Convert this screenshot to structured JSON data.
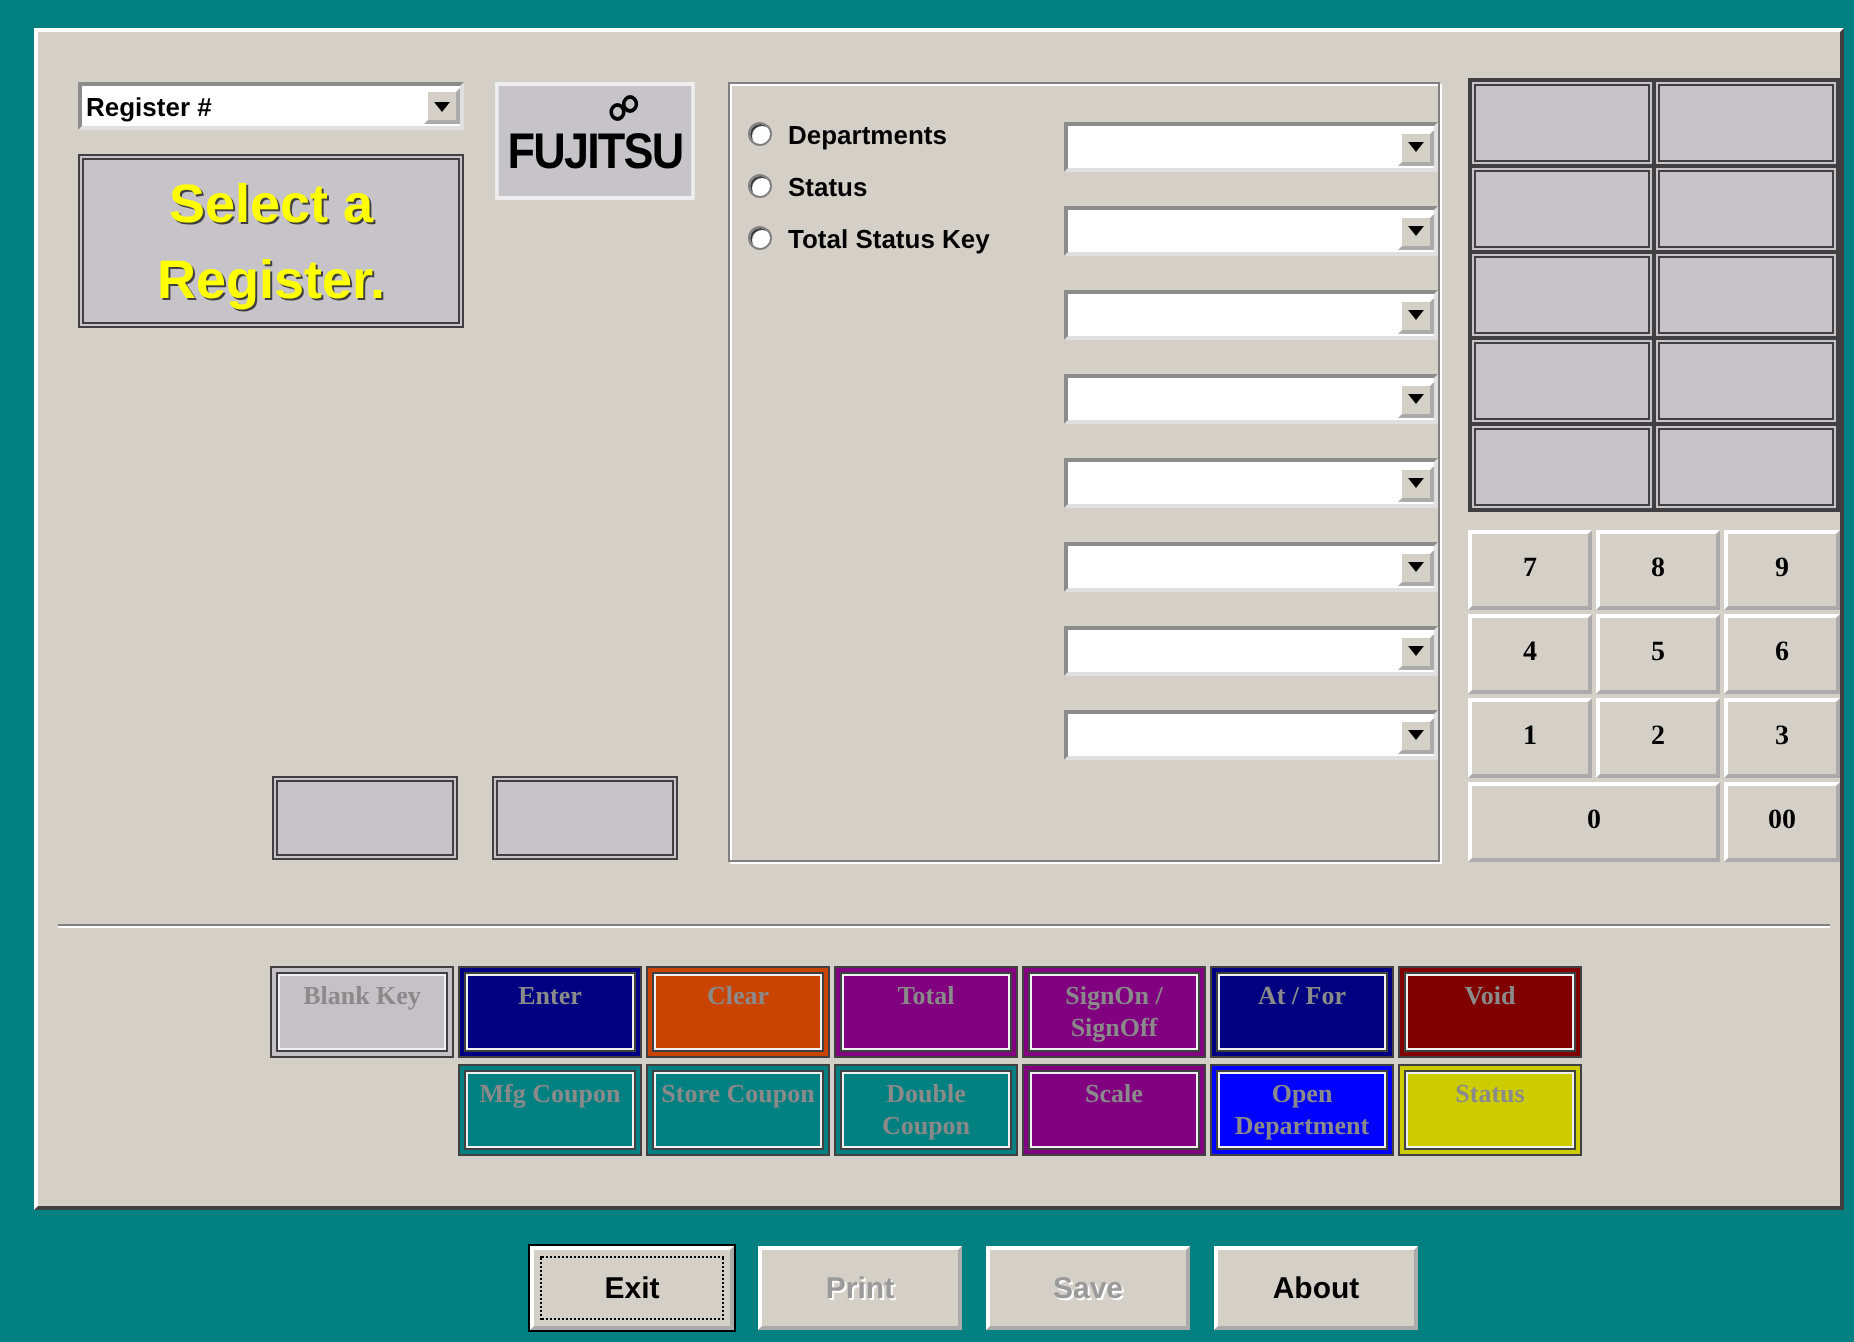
{
  "register_select": {
    "value": "Register #"
  },
  "message": "Select a Register.",
  "logo": "FUJITSU",
  "modes": [
    {
      "label": "Departments",
      "selected": false
    },
    {
      "label": "Status",
      "selected": false
    },
    {
      "label": "Total Status Key",
      "selected": false
    }
  ],
  "keypad": [
    {
      "label": "7",
      "wide": false
    },
    {
      "label": "8",
      "wide": false
    },
    {
      "label": "9",
      "wide": false
    },
    {
      "label": "4",
      "wide": false
    },
    {
      "label": "5",
      "wide": false
    },
    {
      "label": "6",
      "wide": false
    },
    {
      "label": "1",
      "wide": false
    },
    {
      "label": "2",
      "wide": false
    },
    {
      "label": "3",
      "wide": false
    },
    {
      "label": "0",
      "wide": true
    },
    {
      "label": "00",
      "wide": false
    }
  ],
  "function_keys": [
    [
      {
        "label": "Blank Key",
        "color": "#c4c2c6"
      },
      {
        "label": "Enter",
        "color": "#000080"
      },
      {
        "label": "Clear",
        "color": "#c84400"
      },
      {
        "label": "Total",
        "color": "#800080"
      },
      {
        "label": "SignOn / SignOff",
        "color": "#800080"
      },
      {
        "label": "At / For",
        "color": "#000080"
      },
      {
        "label": "Void",
        "color": "#800000"
      }
    ],
    [
      {
        "label": "Mfg Coupon",
        "color": "#008080"
      },
      {
        "label": "Store Coupon",
        "color": "#008080"
      },
      {
        "label": "Double Coupon",
        "color": "#008080"
      },
      {
        "label": "Scale",
        "color": "#800080"
      },
      {
        "label": "Open Department",
        "color": "#0000ff"
      },
      {
        "label": "Status",
        "color": "#cccc00"
      }
    ]
  ],
  "buttons": [
    {
      "label": "Exit",
      "disabled": false,
      "focused": true
    },
    {
      "label": "Print",
      "disabled": true,
      "focused": false
    },
    {
      "label": "Save",
      "disabled": true,
      "focused": false
    },
    {
      "label": "About",
      "disabled": false,
      "focused": false
    }
  ]
}
